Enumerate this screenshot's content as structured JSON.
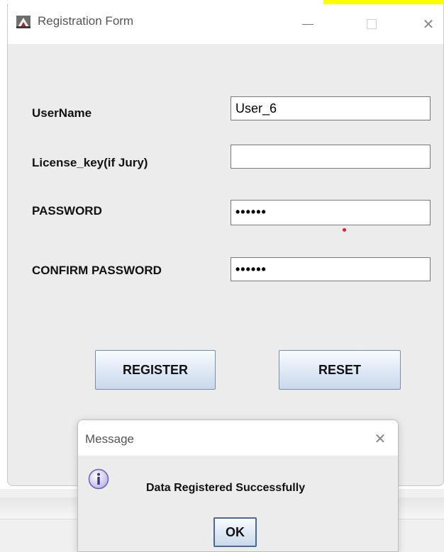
{
  "window": {
    "title": "Registration Form",
    "icons": {
      "app": "java-app-icon",
      "minimize": "minimize-icon",
      "maximize": "maximize-icon",
      "close": "close-icon"
    }
  },
  "form": {
    "username": {
      "label": "UserName",
      "value": "User_6"
    },
    "license": {
      "label": "License_key(if Jury)",
      "value": ""
    },
    "password": {
      "label": "PASSWORD",
      "value": "••••••"
    },
    "confirm": {
      "label": "CONFIRM PASSWORD",
      "value": "••••••"
    }
  },
  "buttons": {
    "register": "REGISTER",
    "reset": "RESET"
  },
  "dialog": {
    "title": "Message",
    "message": "Data Registered Successfully",
    "ok": "OK",
    "icon": "info-icon"
  },
  "colors": {
    "button_gradient_top": "#f7fbff",
    "button_gradient_bottom": "#c9d8ea",
    "window_bg": "#ececec",
    "highlight": "#ffff00"
  }
}
